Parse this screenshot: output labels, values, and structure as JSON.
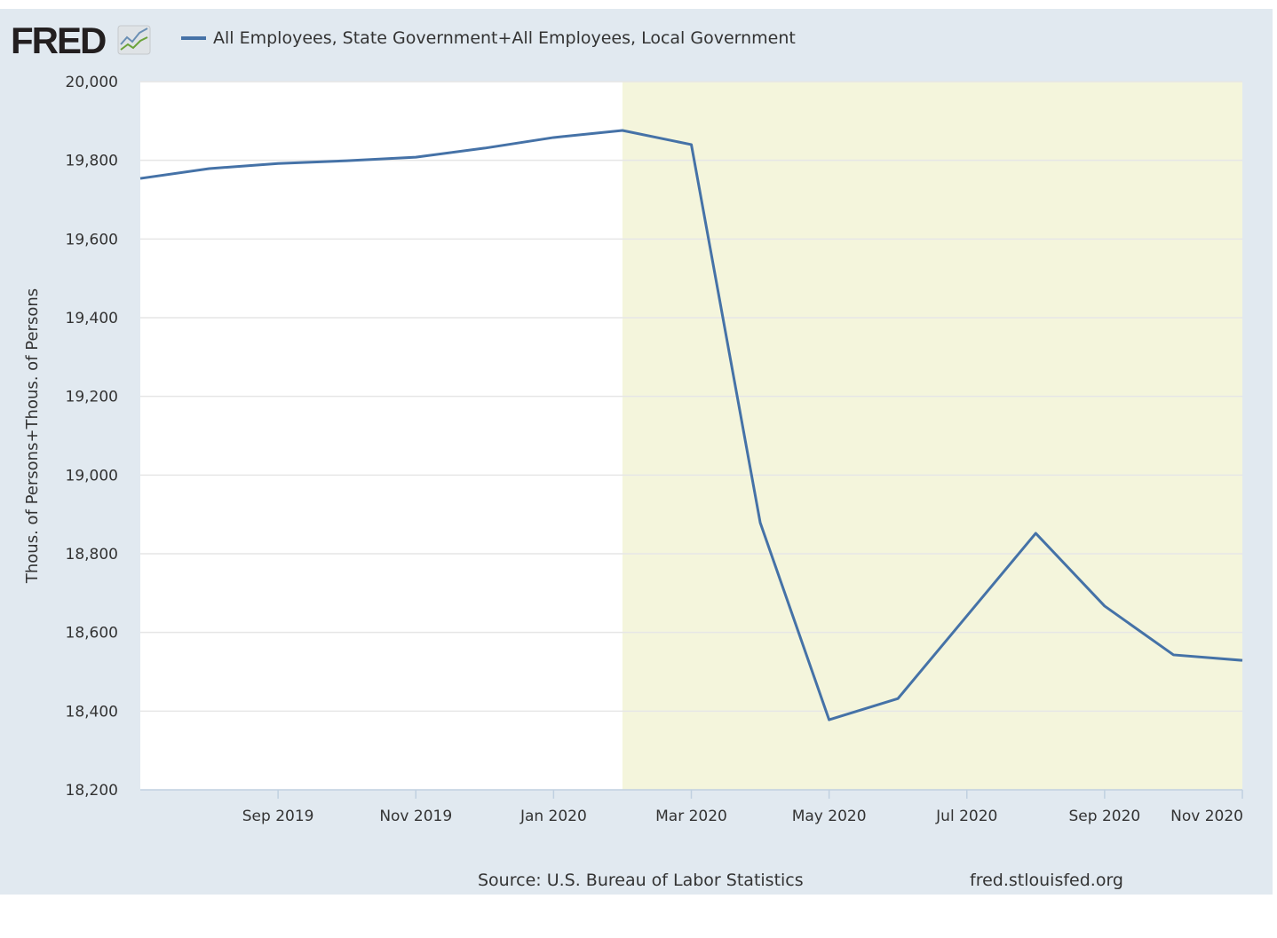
{
  "header": {
    "logo": "FRED",
    "legend_label": "All Employees, State Government+All Employees, Local Government",
    "series_color": "#4572a7"
  },
  "footer": {
    "source": "Source: U.S. Bureau of Labor Statistics",
    "site": "fred.stlouisfed.org"
  },
  "chart_data": {
    "type": "line",
    "ylabel": "Thous. of Persons+Thous. of Persons",
    "ylim": [
      18200,
      20000
    ],
    "yticks": [
      18200,
      18400,
      18600,
      18800,
      19000,
      19200,
      19400,
      19600,
      19800,
      20000
    ],
    "ytick_labels": [
      "18,200",
      "18,400",
      "18,600",
      "18,800",
      "19,000",
      "19,200",
      "19,400",
      "19,600",
      "19,800",
      "20,000"
    ],
    "xtick_labels": [
      "Sep 2019",
      "Nov 2019",
      "Jan 2020",
      "Mar 2020",
      "May 2020",
      "Jul 2020",
      "Sep 2020",
      "Nov 2020"
    ],
    "xtick_index": [
      2,
      4,
      6,
      8,
      10,
      12,
      14,
      16
    ],
    "x": [
      "2019-07",
      "2019-08",
      "2019-09",
      "2019-10",
      "2019-11",
      "2019-12",
      "2020-01",
      "2020-02",
      "2020-03",
      "2020-04",
      "2020-05",
      "2020-06",
      "2020-07",
      "2020-08",
      "2020-09",
      "2020-10",
      "2020-11"
    ],
    "series": [
      {
        "name": "All Employees, State Government+All Employees, Local Government",
        "values": [
          19754,
          19779,
          19792,
          19799,
          19808,
          19831,
          19858,
          19876,
          19840,
          18879,
          18378,
          18432,
          18642,
          18852,
          18667,
          18543,
          18529
        ]
      }
    ],
    "recession_shading": {
      "start": "2020-02",
      "end": "2020-11",
      "color": "#f4f5dc"
    },
    "grid": true,
    "legend_placement": "top-left"
  }
}
